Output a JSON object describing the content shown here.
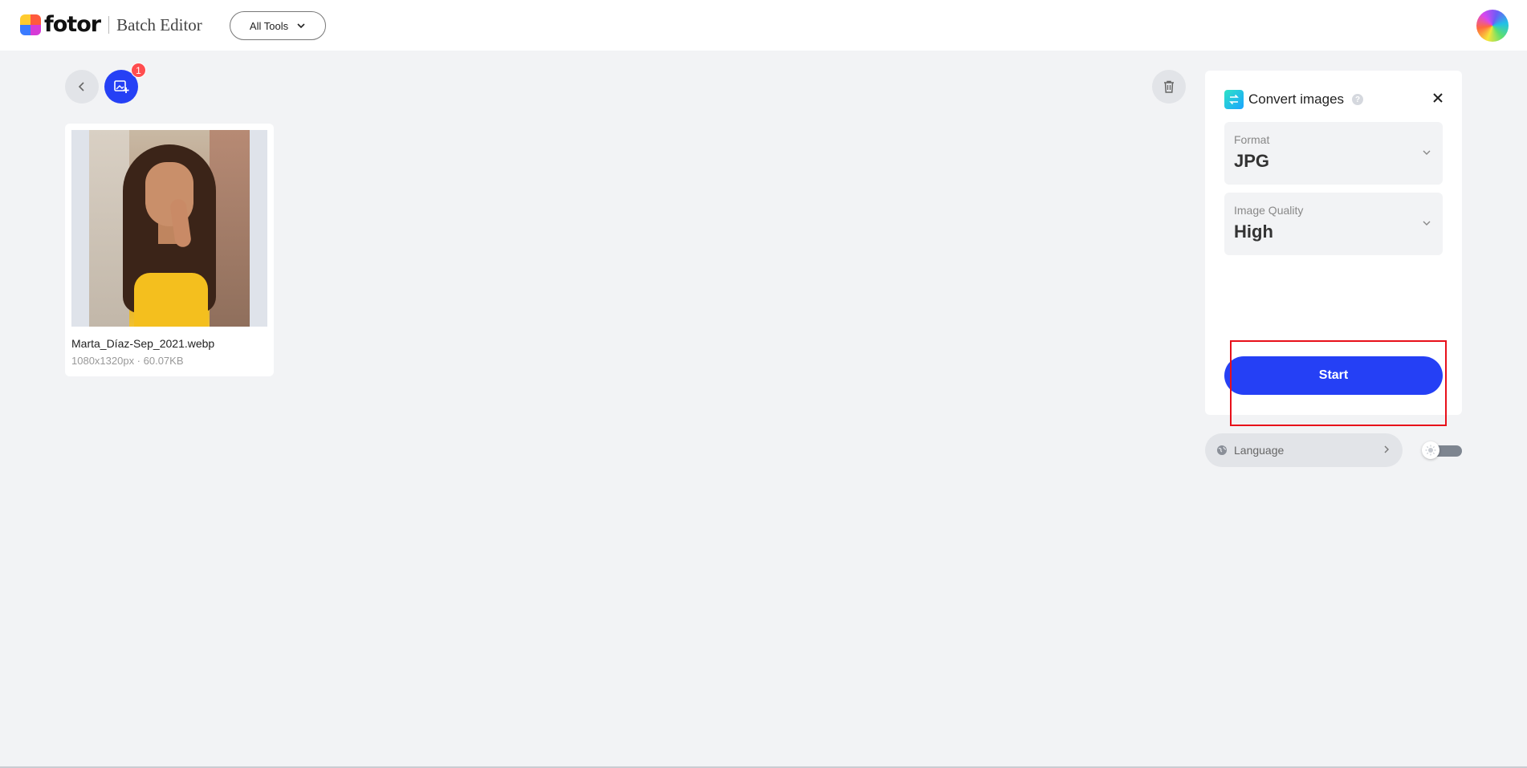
{
  "header": {
    "logo_text": "fotor",
    "product_name": "Batch Editor",
    "all_tools_label": "All Tools"
  },
  "toolbar": {
    "badge_count": "1"
  },
  "images": [
    {
      "file_name": "Marta_Díaz-Sep_2021.webp",
      "meta": "1080x1320px · 60.07KB"
    }
  ],
  "panel": {
    "title": "Convert images",
    "help_glyph": "?",
    "format": {
      "label": "Format",
      "value": "JPG"
    },
    "quality": {
      "label": "Image Quality",
      "value": "High"
    },
    "start_label": "Start"
  },
  "footer": {
    "language_label": "Language"
  },
  "colors": {
    "accent": "#2540f5",
    "badge": "#ff4d4f",
    "background": "#f2f3f5",
    "highlight": "#e8101a"
  },
  "icons": [
    "fotor-logo-icon",
    "chevron-down-icon",
    "back-icon",
    "add-image-icon",
    "trash-icon",
    "convert-icon",
    "help-icon",
    "close-icon",
    "globe-icon",
    "chevron-right-icon",
    "sun-icon"
  ]
}
